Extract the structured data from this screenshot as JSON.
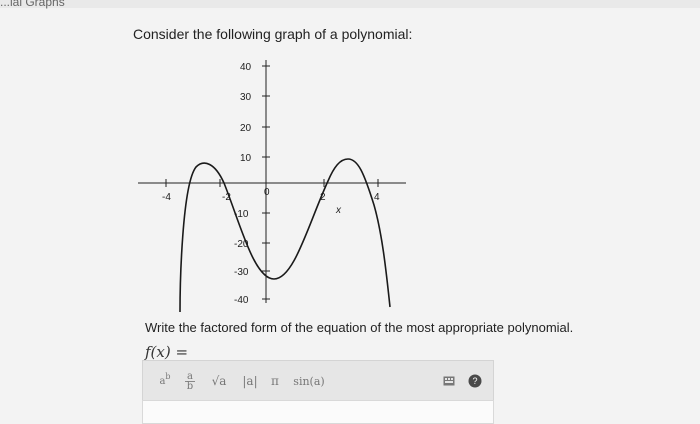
{
  "header": {
    "left_fragment": "...ial Graphs",
    "right_fragment": ""
  },
  "prompt": "Consider the following graph of a polynomial:",
  "question": "Write the factored form of the equation of the most appropriate polynomial.",
  "answer_lhs": "f(x) =",
  "graph": {
    "x_tick_labels": [
      "-4",
      "-2",
      "0",
      "2",
      "4"
    ],
    "y_tick_labels": [
      "40",
      "30",
      "20",
      "10",
      "-10",
      "-20",
      "-30",
      "-40"
    ],
    "x_axis_label": "x",
    "curve_color": "#1a1a1a"
  },
  "toolbar": {
    "exponent": "ab",
    "fraction": "a/b",
    "sqrt": "√a",
    "abs": "|a|",
    "pi": "π",
    "sin": "sin(a)",
    "keyboard_icon": "keyboard-icon",
    "help_icon": "help-icon"
  }
}
